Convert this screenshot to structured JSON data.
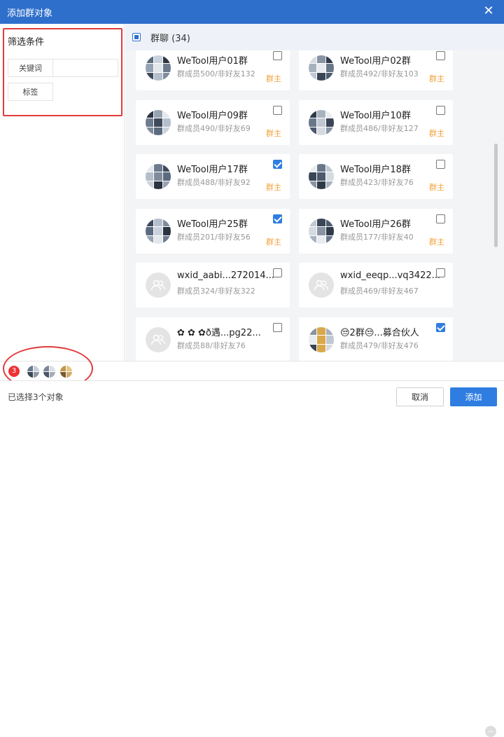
{
  "window": {
    "title": "添加群对象"
  },
  "filter": {
    "title": "筛选条件",
    "keyword_label": "关键词",
    "tag_label": "标签"
  },
  "group_header": {
    "label": "群聊",
    "count": "(34)"
  },
  "cards": [
    {
      "name": "WeTool用户01群",
      "meta": "群成员500/非好友132",
      "owner": "群主",
      "checked": false,
      "avatar": "grid"
    },
    {
      "name": "WeTool用户02群",
      "meta": "群成员492/非好友103",
      "owner": "群主",
      "checked": false,
      "avatar": "grid"
    },
    {
      "name": "WeTool用户09群",
      "meta": "群成员490/非好友69",
      "owner": "群主",
      "checked": false,
      "avatar": "grid"
    },
    {
      "name": "WeTool用户10群",
      "meta": "群成员486/非好友127",
      "owner": "群主",
      "checked": false,
      "avatar": "grid"
    },
    {
      "name": "WeTool用户17群",
      "meta": "群成员488/非好友92",
      "owner": "群主",
      "checked": true,
      "avatar": "grid"
    },
    {
      "name": "WeTool用户18群",
      "meta": "群成员423/非好友76",
      "owner": "群主",
      "checked": false,
      "avatar": "grid"
    },
    {
      "name": "WeTool用户25群",
      "meta": "群成员201/非好友56",
      "owner": "群主",
      "checked": true,
      "avatar": "grid"
    },
    {
      "name": "WeTool用户26群",
      "meta": "群成员177/非好友40",
      "owner": "群主",
      "checked": false,
      "avatar": "grid"
    },
    {
      "name": "wxid_aabi...272014...",
      "meta": "群成员324/非好友322",
      "owner": "",
      "checked": false,
      "avatar": "placeholder"
    },
    {
      "name": "wxid_eeqp...vq3422...",
      "meta": "群成员469/非好友467",
      "owner": "",
      "checked": false,
      "avatar": "placeholder"
    },
    {
      "name": "✿ ✿ ✿ð遇...pg22...",
      "meta": "群成员88/非好友76",
      "owner": "",
      "checked": false,
      "avatar": "placeholder"
    },
    {
      "name": "😒2群😒...募合伙人",
      "meta": "群成员479/非好友476",
      "owner": "",
      "checked": true,
      "avatar": "grid"
    }
  ],
  "selected": {
    "count": "3"
  },
  "footer": {
    "status": "已选择3个对象",
    "cancel_label": "取消",
    "add_label": "添加"
  },
  "colors": {
    "accent": "#2f7de1",
    "titlebar": "#2f6fcc",
    "owner": "#f2a23c",
    "annotation": "#e03c3c"
  }
}
